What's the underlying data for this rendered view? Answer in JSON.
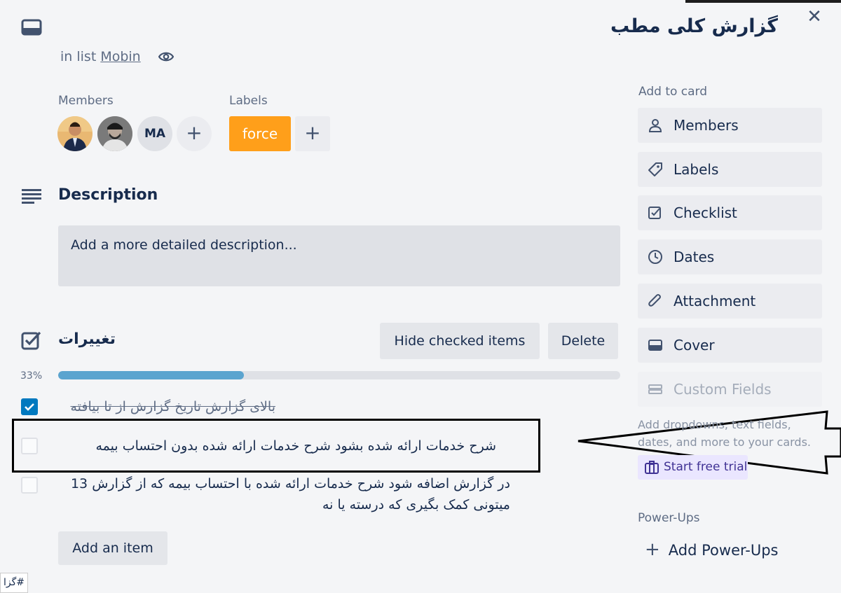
{
  "card": {
    "title": "گزارش کلی مطب",
    "in_list_prefix": "in list",
    "list_name": "Mobin",
    "close_glyph": "✕"
  },
  "members": {
    "label": "Members",
    "avatars": [
      {
        "kind": "photo",
        "name": "member-1"
      },
      {
        "kind": "photo",
        "name": "member-2"
      },
      {
        "kind": "initials",
        "initials": "MA"
      }
    ],
    "add_glyph": "+"
  },
  "labels": {
    "label": "Labels",
    "items": [
      {
        "text": "force",
        "color": "#ff9f1a"
      }
    ],
    "add_glyph": "+"
  },
  "description": {
    "heading": "Description",
    "placeholder": "Add a more detailed description..."
  },
  "checklist": {
    "title": "تغییرات",
    "hide_checked_label": "Hide checked items",
    "delete_label": "Delete",
    "progress_percent": 33,
    "progress_label": "33%",
    "items": [
      {
        "text": "بالای گزارش تاریخ گزارش از تا بیافته",
        "checked": true
      },
      {
        "text": "شرح خدمات ارائه شده بشود شرح خدمات ارائه شده بدون احتساب بیمه",
        "checked": false
      },
      {
        "text": "در گزارش اضافه شود شرح خدمات ارائه شده با احتساب بیمه که از گزارش 13 میتونی کمک بگیری که درسته یا نه",
        "checked": false
      }
    ],
    "add_item_label": "Add an item"
  },
  "sidebar": {
    "add_to_card_heading": "Add to card",
    "buttons": [
      {
        "label": "Members",
        "icon": "person-icon"
      },
      {
        "label": "Labels",
        "icon": "tag-icon"
      },
      {
        "label": "Checklist",
        "icon": "checkbox-icon"
      },
      {
        "label": "Dates",
        "icon": "clock-icon"
      },
      {
        "label": "Attachment",
        "icon": "paperclip-icon"
      },
      {
        "label": "Cover",
        "icon": "cover-icon"
      },
      {
        "label": "Custom Fields",
        "icon": "custom-fields-icon",
        "disabled": true
      }
    ],
    "custom_fields_desc": "Add dropdowns, text fields, dates, and more to your cards.",
    "trial_label": "Start free trial",
    "powerups_heading": "Power-Ups",
    "add_powerups_label": "Add Power-Ups"
  },
  "status_bar": {
    "text": "#گزا"
  },
  "colors": {
    "accent": "#0079bf",
    "progress": "#5ba4cf",
    "label_orange": "#ff9f1a"
  }
}
